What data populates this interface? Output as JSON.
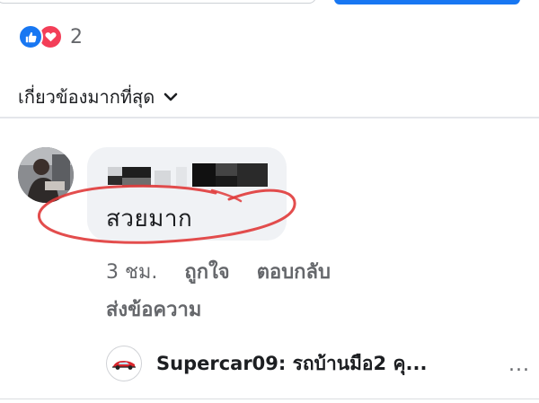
{
  "reactions": {
    "icons": [
      "like-icon",
      "love-icon"
    ],
    "count": "2",
    "colors": {
      "like": "#1877f2",
      "love": "#f33e58"
    }
  },
  "sort": {
    "label": "เกี่ยวข้องมากที่สุด",
    "icon": "chevron-down-icon"
  },
  "comment": {
    "author_redacted": true,
    "text": "สวยมาก",
    "time": "3 ชม.",
    "like_label": "ถูกใจ",
    "reply_label": "ตอบกลับ",
    "send_message_label": "ส่งข้อความ",
    "annotation_color": "#e03a3a"
  },
  "shared_comment": {
    "title": "Supercar09: รถบ้านมือ2 คุ...",
    "thumbnail_icon": "supercar-logo-icon",
    "more_label": "..."
  },
  "colors": {
    "brand": "#1877f2",
    "text": "#1c1e21",
    "secondary_text": "#65676b",
    "bubble": "#f0f2f5"
  }
}
